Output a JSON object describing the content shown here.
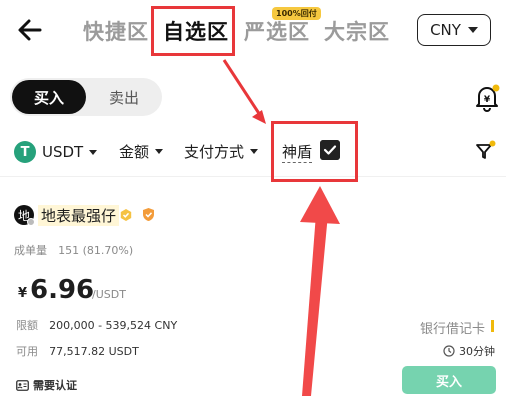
{
  "header": {
    "tabs": [
      {
        "label": "快捷区",
        "active": false
      },
      {
        "label": "自选区",
        "active": true
      },
      {
        "label": "严选区",
        "active": false
      },
      {
        "label": "大宗区",
        "active": false
      }
    ],
    "hot_tag": "100%回付",
    "currency": "CNY"
  },
  "trade_toggle": {
    "buy": "买入",
    "sell": "卖出"
  },
  "filters": {
    "coin": "USDT",
    "coin_icon": "T",
    "amount": "金额",
    "payment": "支付方式",
    "shield": "神盾",
    "shield_checked": true
  },
  "ad": {
    "avatar_char": "地",
    "merchant": "地表最强仔",
    "volume_label": "成单量",
    "volume_value": "151 (81.70%)",
    "price_symbol": "¥",
    "price": "6.96",
    "price_unit": "/USDT",
    "limit_label": "限额",
    "limit_value": "200,000 - 539,524 CNY",
    "available_label": "可用",
    "available_value": "77,517.82 USDT",
    "payment_method": "银行借记卡",
    "time_limit": "30分钟",
    "verify": "需要认证",
    "buy_button": "买入"
  },
  "colors": {
    "annotation": "#e8373a",
    "buy_green": "#2ebd85",
    "accent_yellow": "#f0b90b"
  }
}
